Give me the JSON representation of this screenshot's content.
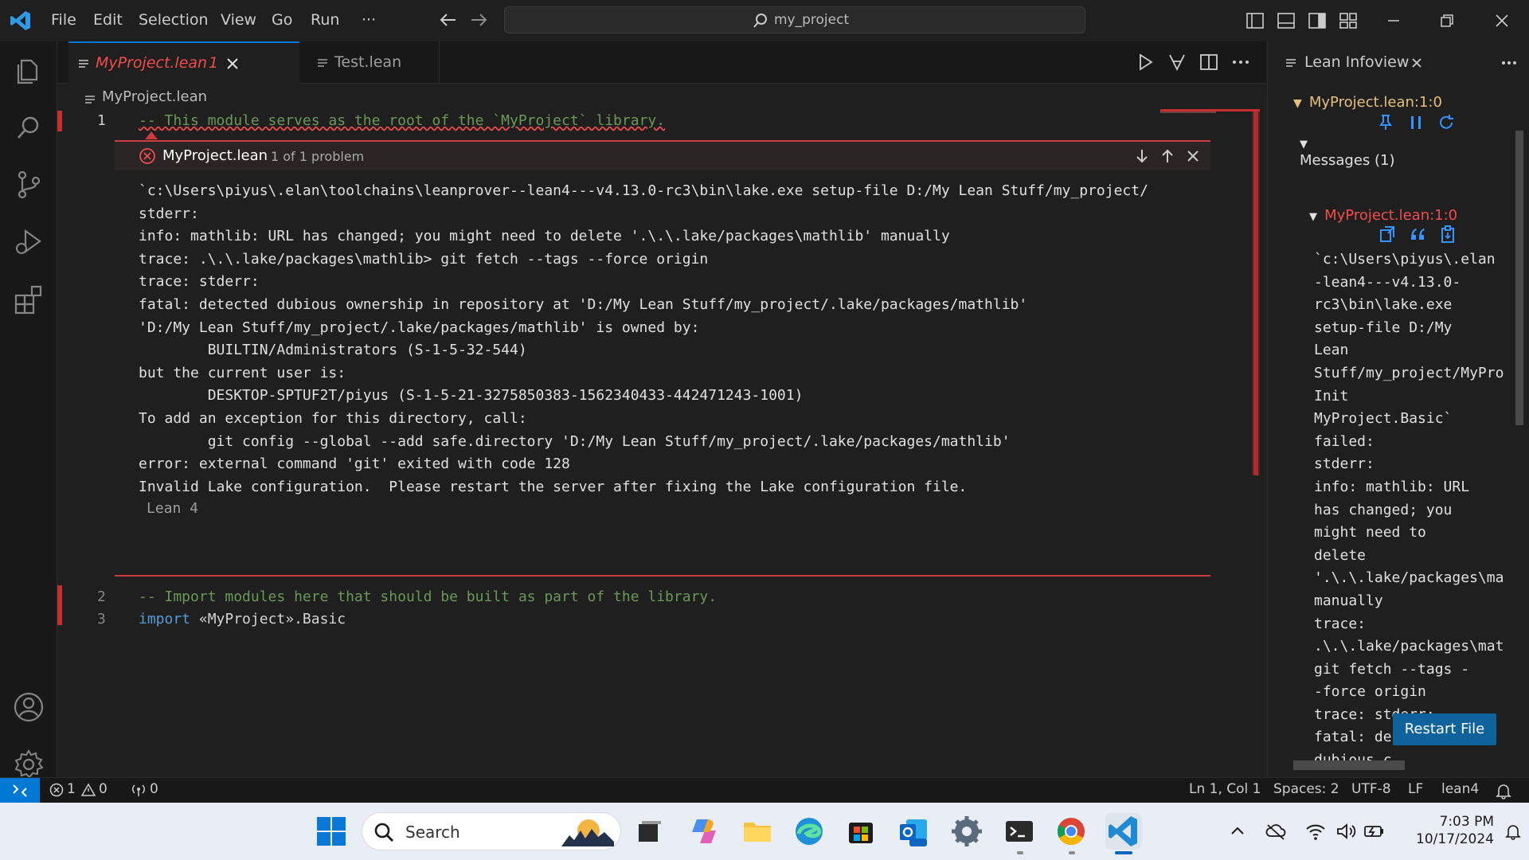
{
  "titlebar": {
    "menu": [
      "File",
      "Edit",
      "Selection",
      "View",
      "Go",
      "Run",
      "···"
    ],
    "search_text": "my_project"
  },
  "tabs": [
    {
      "label": "MyProject.lean",
      "badge": "1"
    },
    {
      "label": "Test.lean"
    }
  ],
  "breadcrumb": "MyProject.lean",
  "editor": {
    "line1_no": "1",
    "line1_text": "-- This module serves as the root of the `MyProject` library.",
    "line2_no": "2",
    "line2_text": "-- Import modules here that should be built as part of the library.",
    "line3_no": "3",
    "line3_kw": "import",
    "line3_text": " «MyProject».Basic"
  },
  "peek": {
    "file": "MyProject.lean",
    "count": "1 of 1 problem",
    "lines": [
      "`c:\\Users\\piyus\\.elan\\toolchains\\leanprover--lean4---v4.13.0-rc3\\bin\\lake.exe setup-file D:/My Lean Stuff/my_project/",
      "",
      "stderr:",
      "info: mathlib: URL has changed; you might need to delete '.\\.\\.lake/packages\\mathlib' manually",
      "trace: .\\.\\.lake/packages\\mathlib> git fetch --tags --force origin",
      "trace: stderr:",
      "fatal: detected dubious ownership in repository at 'D:/My Lean Stuff/my_project/.lake/packages/mathlib'",
      "'D:/My Lean Stuff/my_project/.lake/packages/mathlib' is owned by:",
      "        BUILTIN/Administrators (S-1-5-32-544)",
      "but the current user is:",
      "        DESKTOP-SPTUF2T/piyus (S-1-5-21-3275850383-1562340433-442471243-1001)",
      "To add an exception for this directory, call:",
      "",
      "        git config --global --add safe.directory 'D:/My Lean Stuff/my_project/.lake/packages/mathlib'",
      "error: external command 'git' exited with code 128",
      "Invalid Lake configuration.  Please restart the server after fixing the Lake configuration file."
    ],
    "source": "Lean 4"
  },
  "infoview": {
    "title": "Lean Infoview",
    "header": "MyProject.lean:1:0",
    "messages_label": "Messages (1)",
    "message_header": "MyProject.lean:1:0",
    "message_lines": [
      "`c:\\Users\\piyus\\.elan",
      "-lean4---v4.13.0-",
      "rc3\\bin\\lake.exe",
      "setup-file D:/My",
      "Lean",
      "Stuff/my_project/MyPro",
      "Init",
      "MyProject.Basic`",
      "failed:",
      "",
      "stderr:",
      "info: mathlib: URL",
      "has changed; you",
      "might need to",
      "delete",
      "'.\\.\\.lake/packages\\ma",
      "manually",
      "trace:",
      ".\\.\\.lake/packages\\mat",
      "git fetch --tags -",
      "-force origin",
      "trace: stderr:",
      "fatal: de",
      "dubious c"
    ],
    "restart_label": "Restart File"
  },
  "status": {
    "errors": "1",
    "warnings": "0",
    "ports": "0",
    "position": "Ln 1, Col 1",
    "spaces": "Spaces: 2",
    "encoding": "UTF-8",
    "eol": "LF",
    "language": "lean4"
  },
  "taskbar": {
    "search_label": "Search",
    "time": "7:03 PM",
    "date": "10/17/2024"
  },
  "colors": {
    "error": "#f14c4c",
    "comment": "#6a9955",
    "keyword": "#569cd6",
    "link": "#3794ff",
    "restart": "#0e639c"
  }
}
